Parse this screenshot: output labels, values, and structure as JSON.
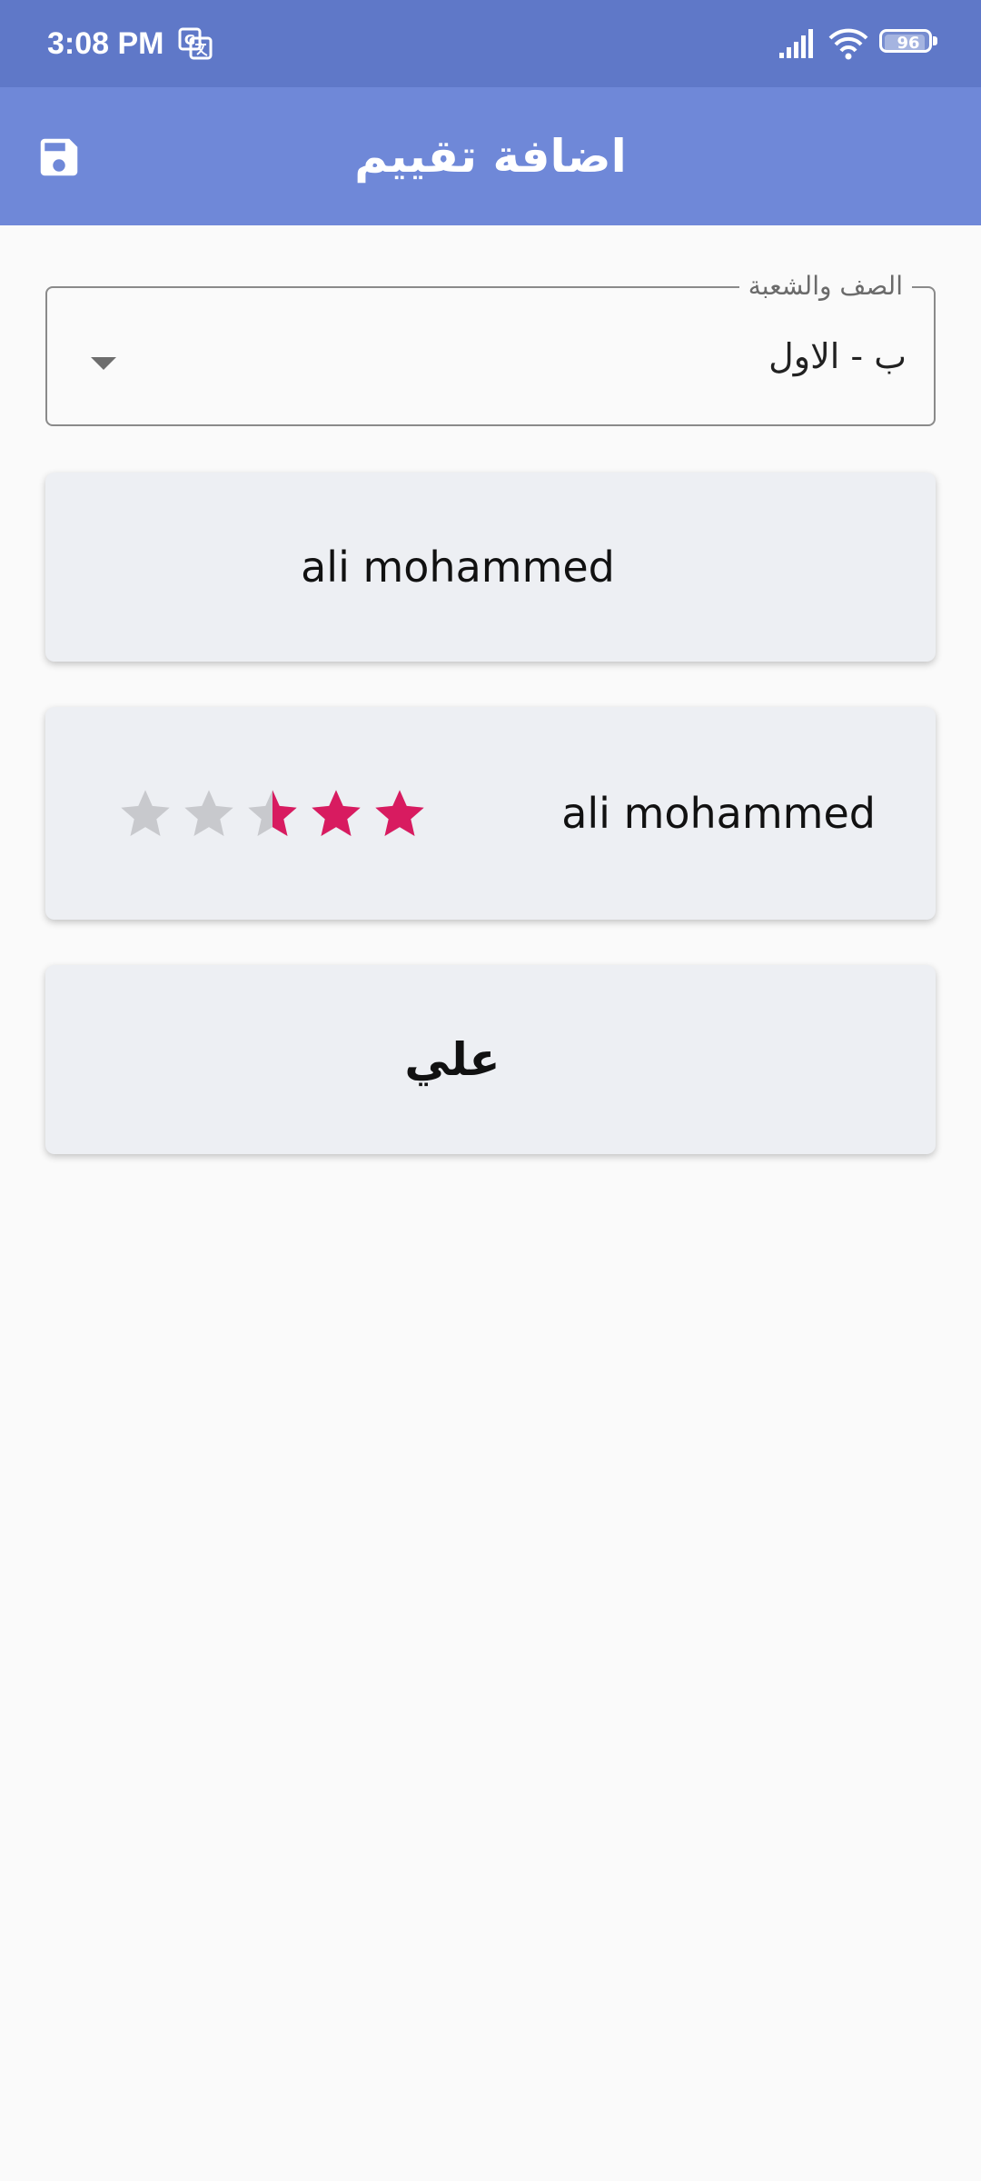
{
  "status_bar": {
    "time": "3:08 PM",
    "battery": "96",
    "battery_level": 0.96
  },
  "app_bar": {
    "title": "اضافة تقييم",
    "save_icon": "save-icon"
  },
  "class_select": {
    "label": "الصف والشعبة",
    "value": "ب - الاول"
  },
  "students": [
    {
      "name": "ali mohammed"
    },
    {
      "name": "ali mohammed",
      "rating": 2.5,
      "max_rating": 5
    },
    {
      "name": "علي"
    }
  ],
  "colors": {
    "status_bar": "#5f78c8",
    "app_bar": "#6f88d8",
    "star_filled": "#d81b60",
    "star_empty": "#c8c9cd"
  }
}
